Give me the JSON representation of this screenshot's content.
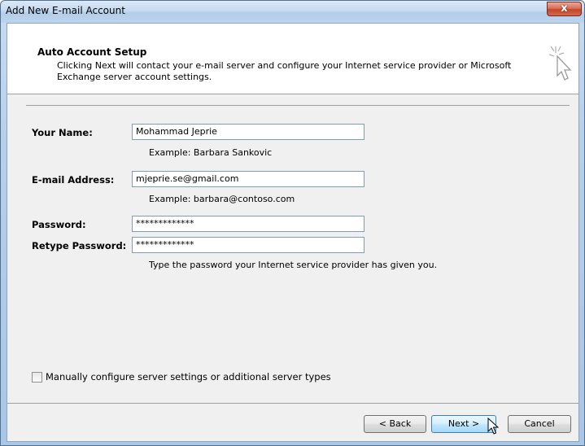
{
  "window": {
    "title": "Add New E-mail Account",
    "close_glyph": "x"
  },
  "header": {
    "title": "Auto Account Setup",
    "description": "Clicking Next will contact your e-mail server and configure your Internet service provider or Microsoft Exchange server account settings.",
    "icon": "cursor-sparkle-icon"
  },
  "form": {
    "name": {
      "label": "Your Name:",
      "value": "Mohammad Jeprie",
      "example": "Example: Barbara Sankovic"
    },
    "email": {
      "label": "E-mail Address:",
      "value": "mjeprie.se@gmail.com",
      "example": "Example: barbara@contoso.com"
    },
    "password": {
      "label": "Password:",
      "value": "*************"
    },
    "retype_password": {
      "label": "Retype Password:",
      "value": "*************"
    },
    "password_hint": "Type the password your Internet service provider has given you."
  },
  "manual_config": {
    "label": "Manually configure server settings or additional server types",
    "checked": false
  },
  "buttons": {
    "back": "< Back",
    "next": "Next >",
    "cancel": "Cancel"
  },
  "colors": {
    "field_border": "#7f9db9",
    "default_button_border": "#3c7fb1",
    "close_button": "#c5442a"
  }
}
